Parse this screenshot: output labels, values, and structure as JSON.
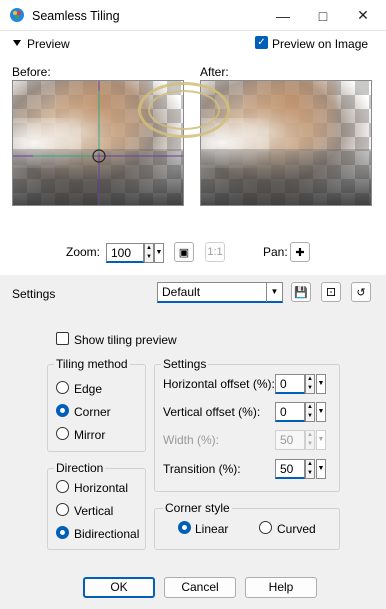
{
  "window": {
    "title": "Seamless Tiling"
  },
  "preview": {
    "label": "Preview",
    "preview_on_image": "Preview on Image",
    "before": "Before:",
    "after": "After:"
  },
  "zoom": {
    "label": "Zoom:",
    "value": "100",
    "pan": "Pan:"
  },
  "settings": {
    "label": "Settings",
    "preset": "Default"
  },
  "options": {
    "show_tiling_preview": "Show tiling preview",
    "tiling_method": {
      "title": "Tiling method",
      "items": [
        "Edge",
        "Corner",
        "Mirror"
      ],
      "selected": "Corner"
    },
    "direction": {
      "title": "Direction",
      "items": [
        "Horizontal",
        "Vertical",
        "Bidirectional"
      ],
      "selected": "Bidirectional"
    },
    "group_settings": {
      "title": "Settings",
      "horizontal_offset": {
        "label": "Horizontal offset (%):",
        "value": "0"
      },
      "vertical_offset": {
        "label": "Vertical offset (%):",
        "value": "0"
      },
      "width": {
        "label": "Width (%):",
        "value": "50"
      },
      "transition": {
        "label": "Transition (%):",
        "value": "50"
      }
    },
    "corner_style": {
      "title": "Corner style",
      "items": [
        "Linear",
        "Curved"
      ],
      "selected": "Linear"
    }
  },
  "buttons": {
    "ok": "OK",
    "cancel": "Cancel",
    "help": "Help"
  },
  "colors": {
    "accent": "#005fb8"
  }
}
